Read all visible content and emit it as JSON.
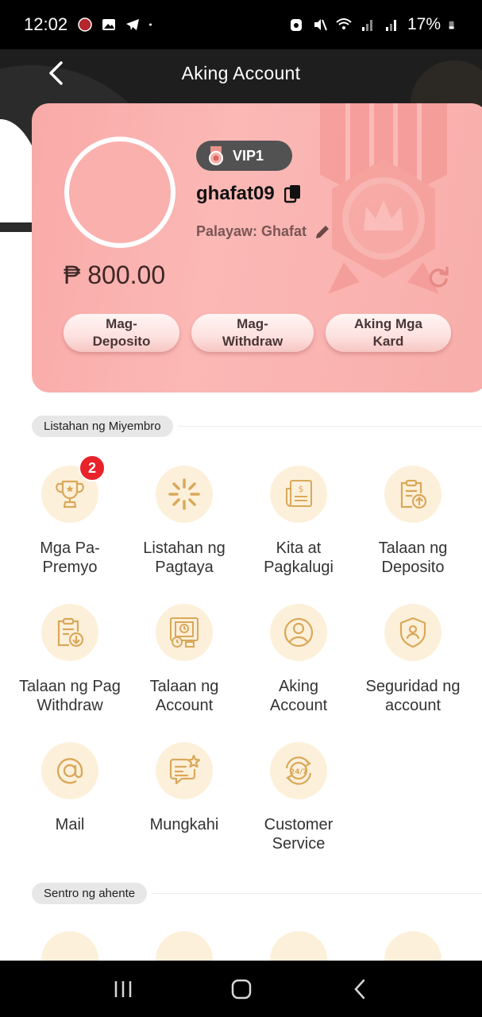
{
  "status_bar": {
    "time": "12:02",
    "battery": "17%",
    "icons": [
      "app-icon",
      "gallery-icon",
      "telegram-icon",
      "dot-icon",
      "alarm-icon",
      "mute-icon",
      "wifi-icon",
      "signal-icon",
      "signal-icon",
      "battery-icon"
    ]
  },
  "header": {
    "title": "Aking Account",
    "back_icon": "chevron-left-icon"
  },
  "account_card": {
    "vip_label": "VIP1",
    "username": "ghafat09",
    "nickname": "Palayaw: Ghafat",
    "balance": "₱ 800.00",
    "buttons": {
      "deposit": "Mag-\nDeposito",
      "withdraw": "Mag-\nWithdraw",
      "cards": "Aking Mga\nKard"
    }
  },
  "members_section": {
    "title": "Listahan ng Miyembro",
    "items": [
      {
        "label": "Mga Pa-\nPremyo",
        "icon": "trophy-icon",
        "badge": "2"
      },
      {
        "label": "Listahan ng\nPagtaya",
        "icon": "sparkle-icon"
      },
      {
        "label": "Kita at\nPagkalugi",
        "icon": "receipt-icon"
      },
      {
        "label": "Talaan ng\nDeposito",
        "icon": "clipboard-upload-icon"
      },
      {
        "label": "Talaan ng Pag\nWithdraw",
        "icon": "clipboard-download-icon"
      },
      {
        "label": "Talaan ng\nAccount",
        "icon": "account-record-icon"
      },
      {
        "label": "Aking\nAccount",
        "icon": "user-icon"
      },
      {
        "label": "Seguridad ng\naccount",
        "icon": "shield-user-icon"
      },
      {
        "label": "Mail",
        "icon": "at-sign-icon"
      },
      {
        "label": "Mungkahi",
        "icon": "feedback-icon"
      },
      {
        "label": "Customer\nService",
        "icon": "support-24-7-icon"
      }
    ]
  },
  "agent_section": {
    "title": "Sentro ng ahente"
  },
  "colors": {
    "card_pink": "#fbb2af",
    "icon_bg": "#fdf0da",
    "icon_stroke": "#d9a85a",
    "badge_red": "#e8232a",
    "header_dark": "#1e1e1e"
  }
}
